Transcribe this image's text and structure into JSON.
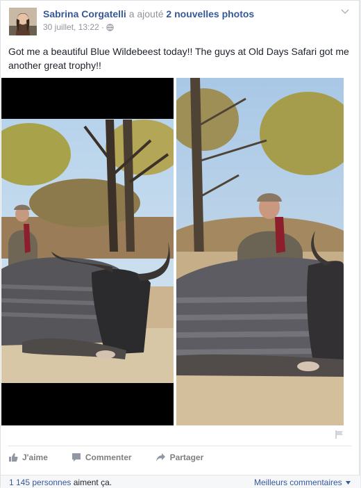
{
  "post": {
    "author": "Sabrina Corgatelli",
    "action_text": "a ajouté",
    "photo_count_text": "2 nouvelles photos",
    "timestamp": "30 juillet, 13:22",
    "separator": "·",
    "audience_icon": "globe-icon",
    "text": "Got me a beautiful Blue Wildebeest today!! The guys at Old Days Safari got me another great trophy!!"
  },
  "photos": [
    {
      "description_icon": "photo-thumbnail"
    },
    {
      "description_icon": "photo-thumbnail"
    }
  ],
  "actions": {
    "like_label": "J'aime",
    "comment_label": "Commenter",
    "share_label": "Partager"
  },
  "footer": {
    "likes_link": "1 145 personnes",
    "likes_suffix": "aiment ça.",
    "best_comments": "Meilleurs commentaires"
  },
  "colors": {
    "link": "#365899",
    "secondary_text": "#90949c",
    "action_text": "#7f7f7f"
  }
}
